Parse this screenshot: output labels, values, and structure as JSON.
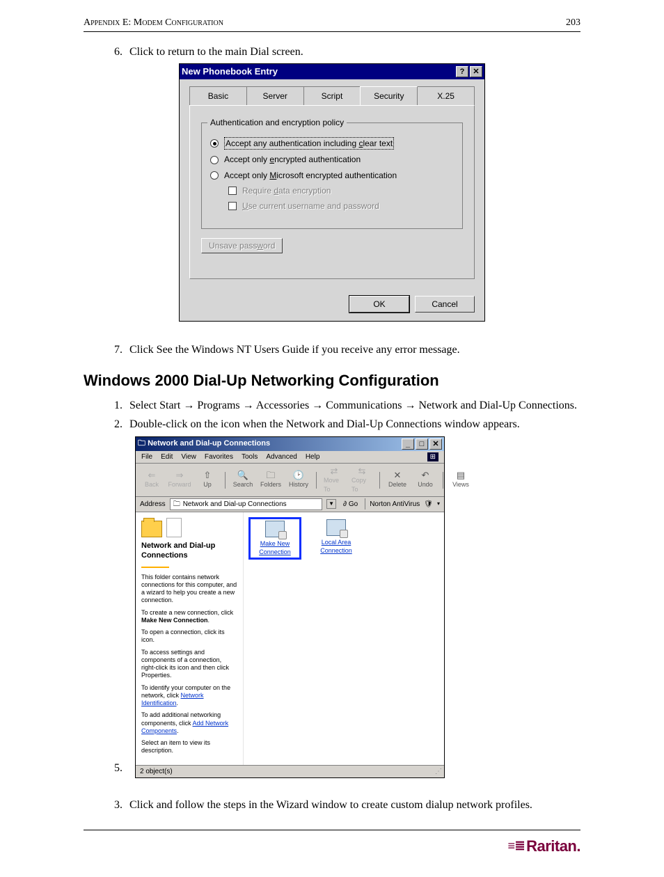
{
  "header": {
    "left": "Appendix E: Modem Configuration",
    "right": "203"
  },
  "step6": "Click        to return to the main Dial screen.",
  "dlg1": {
    "title": "New Phonebook Entry",
    "help_btn": "?",
    "close_btn": "✕",
    "tabs": [
      "Basic",
      "Server",
      "Script",
      "Security",
      "X.25"
    ],
    "group_legend": "Authentication and encryption policy",
    "opt1_pre": "Accept any authentication including ",
    "opt1_u": "c",
    "opt1_post": "lear text",
    "opt2_pre": "Accept only ",
    "opt2_u": "e",
    "opt2_post": "ncrypted authentication",
    "opt3_pre": "Accept only ",
    "opt3_u": "M",
    "opt3_post": "icrosoft encrypted authentication",
    "chk1_pre": "Require ",
    "chk1_u": "d",
    "chk1_post": "ata encryption",
    "chk2_u": "U",
    "chk2_post": "se current username and password",
    "unsave_pre": "Unsave pass",
    "unsave_u": "w",
    "unsave_post": "ord",
    "ok": "OK",
    "cancel": "Cancel"
  },
  "step7": "Click          See the Windows NT Users Guide if you receive any error message.",
  "heading": "Windows 2000 Dial-Up Networking Configuration",
  "olist": {
    "i1": "Select Start → Programs → Accessories → Communications → Network and Dial-Up Connections.",
    "i2": "Double-click on the                                                  icon when the Network and Dial-Up Connections window appears.",
    "i3": "Click          and follow the steps in the                                   Wizard window to create custom dialup network profiles."
  },
  "num5_label": "5.",
  "win2k": {
    "title": "Network and Dial-up Connections",
    "menu": [
      "File",
      "Edit",
      "View",
      "Favorites",
      "Tools",
      "Advanced",
      "Help"
    ],
    "tools": [
      {
        "g": "⇐",
        "l": "Back"
      },
      {
        "g": "⇒",
        "l": "Forward"
      },
      {
        "g": "⇧",
        "l": "Up"
      },
      {
        "g": "🔍",
        "l": "Search"
      },
      {
        "g": "🗀",
        "l": "Folders"
      },
      {
        "g": "🕑",
        "l": "History"
      },
      {
        "g": "⇄",
        "l": "Move To"
      },
      {
        "g": "⇆",
        "l": "Copy To"
      },
      {
        "g": "✕",
        "l": "Delete"
      },
      {
        "g": "↶",
        "l": "Undo"
      },
      {
        "g": "▤",
        "l": "Views"
      }
    ],
    "addr_label": "Address",
    "addr_value": "Network and Dial-up Connections",
    "go_label": "Go",
    "norton": "Norton AntiVirus",
    "left": {
      "title": "Network and Dial-up Connections",
      "p1": "This folder contains network connections for this computer, and a wizard to help you create a new connection.",
      "p2_a": "To create a new connection, click ",
      "p2_b": "Make New Connection",
      "p3": "To open a connection, click its icon.",
      "p4": "To access settings and components of a connection, right-click its icon and then click Properties.",
      "p5_a": "To identify your computer on the network, click ",
      "p5_link": "Network Identification",
      "p6_a": "To add additional networking components, click ",
      "p6_link": "Add Network Components",
      "p7": "Select an item to view its description."
    },
    "icon1": "Make New Connection",
    "icon2": "Local Area Connection",
    "status": "2 object(s)"
  },
  "brand": "Raritan."
}
